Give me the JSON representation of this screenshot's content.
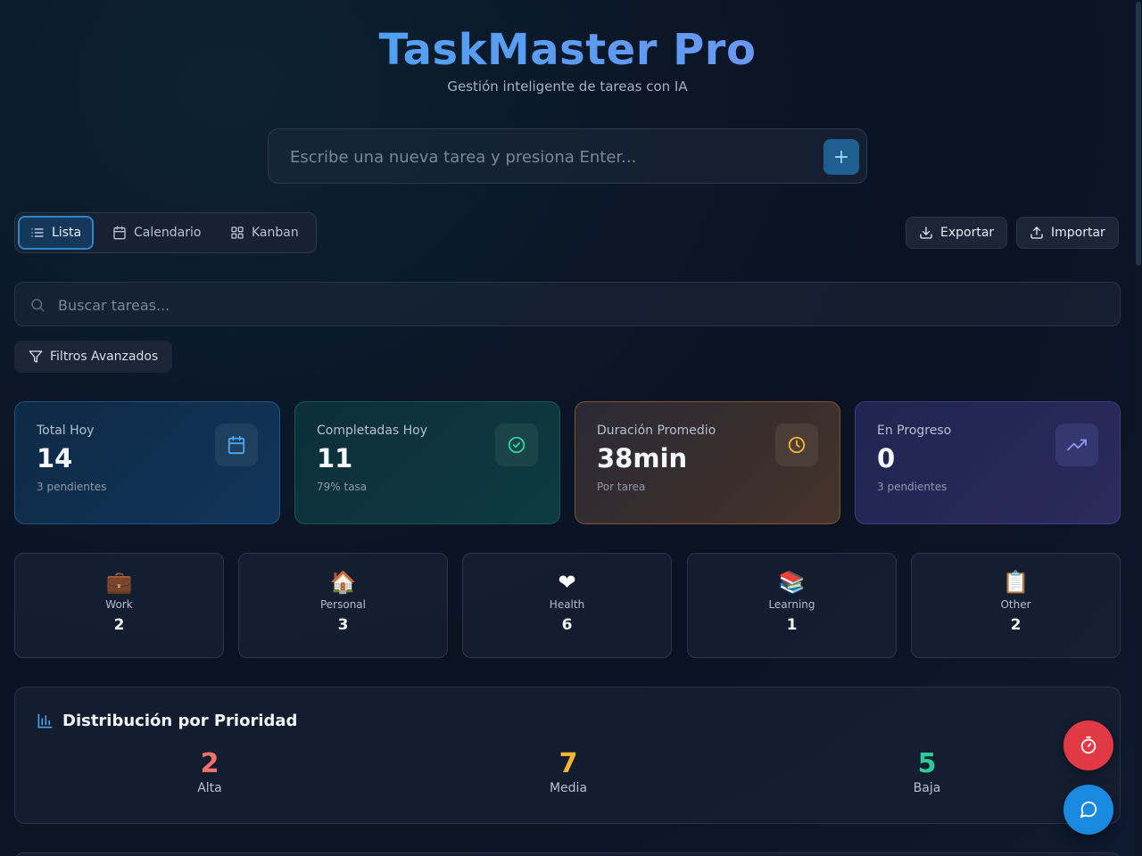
{
  "header": {
    "title": "TaskMaster Pro",
    "subtitle": "Gestión inteligente de tareas con IA"
  },
  "new_task": {
    "placeholder": "Escribe una nueva tarea y presiona Enter...",
    "add_label": "+"
  },
  "views": {
    "active": "Lista",
    "items": [
      {
        "label": "Lista",
        "icon": "list-icon"
      },
      {
        "label": "Calendario",
        "icon": "calendar-icon"
      },
      {
        "label": "Kanban",
        "icon": "kanban-icon"
      }
    ]
  },
  "actions": {
    "export_label": "Exportar",
    "import_label": "Importar"
  },
  "search": {
    "placeholder": "Buscar tareas..."
  },
  "filters": {
    "label": "Filtros Avanzados"
  },
  "stats": [
    {
      "label": "Total Hoy",
      "value": "14",
      "sub": "3 pendientes",
      "icon": "calendar-icon",
      "color": "#4aa8f0"
    },
    {
      "label": "Completadas Hoy",
      "value": "11",
      "sub": "79% tasa",
      "icon": "check-circle-icon",
      "color": "#2fd3a0"
    },
    {
      "label": "Duración Promedio",
      "value": "38min",
      "sub": "Por tarea",
      "icon": "clock-icon",
      "color": "#f5b52e"
    },
    {
      "label": "En Progreso",
      "value": "0",
      "sub": "3 pendientes",
      "icon": "trending-up-icon",
      "color": "#8f95f5"
    }
  ],
  "categories": [
    {
      "emoji": "💼",
      "name": "Work",
      "count": "2"
    },
    {
      "emoji": "🏠",
      "name": "Personal",
      "count": "3"
    },
    {
      "emoji": "❤",
      "name": "Health",
      "count": "6"
    },
    {
      "emoji": "📚",
      "name": "Learning",
      "count": "1"
    },
    {
      "emoji": "📋",
      "name": "Other",
      "count": "2"
    }
  ],
  "priority": {
    "title": "Distribución por Prioridad",
    "items": [
      {
        "value": "2",
        "label": "Alta",
        "color": "#f0716a"
      },
      {
        "value": "7",
        "label": "Media",
        "color": "#f5b52e"
      },
      {
        "value": "5",
        "label": "Baja",
        "color": "#2fc99a"
      }
    ]
  },
  "colors": {
    "accent": "#2c86c9",
    "timer_fab": "#e23a44",
    "chat_fab": "#1a8ae0"
  }
}
